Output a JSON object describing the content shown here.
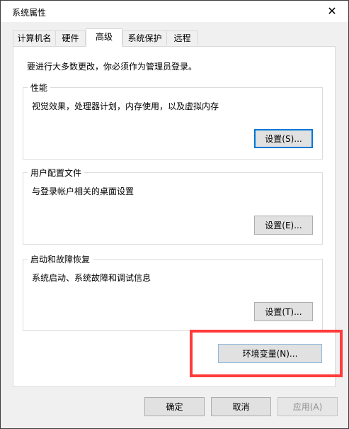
{
  "window": {
    "title": "系统属性",
    "close_glyph": "✕"
  },
  "tabs": [
    {
      "label": "计算机名"
    },
    {
      "label": "硬件"
    },
    {
      "label": "高级",
      "active": true
    },
    {
      "label": "系统保护"
    },
    {
      "label": "远程"
    }
  ],
  "intro": "要进行大多数更改，你必须作为管理员登录。",
  "groups": {
    "performance": {
      "title": "性能",
      "desc": "视觉效果，处理器计划，内存使用，以及虚拟内存",
      "button": "设置(S)..."
    },
    "profiles": {
      "title": "用户配置文件",
      "desc": "与登录帐户相关的桌面设置",
      "button": "设置(E)..."
    },
    "startup": {
      "title": "启动和故障恢复",
      "desc": "系统启动、系统故障和调试信息",
      "button": "设置(T)..."
    }
  },
  "env_button": "环境变量(N)...",
  "footer": {
    "ok": "确定",
    "cancel": "取消",
    "apply": "应用(A)"
  },
  "colors": {
    "highlight": "#ff3b3b",
    "focus": "#0078d7"
  }
}
